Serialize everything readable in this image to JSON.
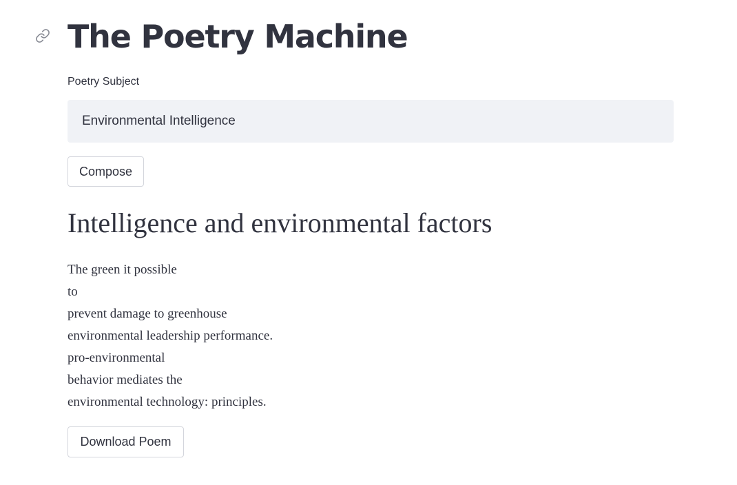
{
  "app": {
    "title": "The Poetry Machine"
  },
  "icons": {
    "anchor": "link-icon"
  },
  "subject_input": {
    "label": "Poetry Subject",
    "value": "Environmental Intelligence"
  },
  "compose_button": {
    "label": "Compose"
  },
  "poem": {
    "title": "Intelligence and environmental factors",
    "lines": [
      "The green it possible",
      "to",
      "prevent damage to greenhouse",
      "environmental leadership performance.",
      "pro-environmental",
      "behavior mediates the",
      "environmental technology: principles."
    ]
  },
  "download_button": {
    "label": "Download Poem"
  }
}
